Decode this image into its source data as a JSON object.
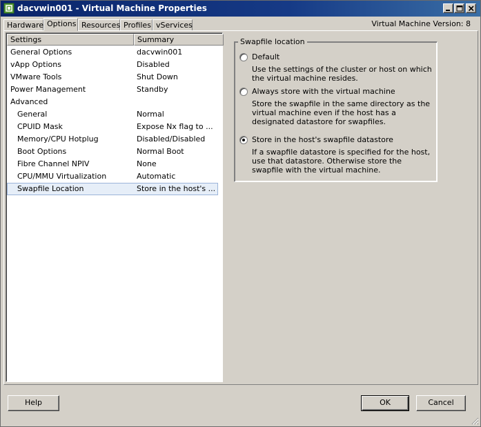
{
  "window": {
    "title": "dacvwin001 - Virtual Machine Properties"
  },
  "tabs": [
    {
      "label": "Hardware",
      "active": false
    },
    {
      "label": "Options",
      "active": true
    },
    {
      "label": "Resources",
      "active": false
    },
    {
      "label": "Profiles",
      "active": false
    },
    {
      "label": "vServices",
      "active": false
    }
  ],
  "version_text": "Virtual Machine Version: 8",
  "settings_table": {
    "columns": [
      "Settings",
      "Summary"
    ],
    "rows": [
      {
        "name": "General Options",
        "summary": "dacvwin001",
        "indent": false
      },
      {
        "name": "vApp Options",
        "summary": "Disabled",
        "indent": false
      },
      {
        "name": "VMware Tools",
        "summary": "Shut Down",
        "indent": false
      },
      {
        "name": "Power Management",
        "summary": "Standby",
        "indent": false
      },
      {
        "name": "Advanced",
        "summary": "",
        "indent": false
      },
      {
        "name": "General",
        "summary": "Normal",
        "indent": true
      },
      {
        "name": "CPUID Mask",
        "summary": "Expose Nx flag to ...",
        "indent": true
      },
      {
        "name": "Memory/CPU Hotplug",
        "summary": "Disabled/Disabled",
        "indent": true
      },
      {
        "name": "Boot Options",
        "summary": "Normal Boot",
        "indent": true
      },
      {
        "name": "Fibre Channel NPIV",
        "summary": "None",
        "indent": true
      },
      {
        "name": "CPU/MMU Virtualization",
        "summary": "Automatic",
        "indent": true
      },
      {
        "name": "Swapfile Location",
        "summary": "Store in the host's ...",
        "indent": true,
        "selected": true
      }
    ]
  },
  "swapfile": {
    "group_label": "Swapfile location",
    "options": [
      {
        "label": "Default",
        "description": "Use the settings of the cluster or host on which the virtual machine resides.",
        "checked": false
      },
      {
        "label": "Always store with the virtual machine",
        "description": "Store the swapfile in the same directory as the virtual machine even if the host has a designated datastore for swapfiles.",
        "checked": false
      },
      {
        "label": "Store in the host's swapfile datastore",
        "description": "If a swapfile datastore is specified for the host, use that datastore. Otherwise store the swapfile with the virtual machine.",
        "checked": true
      }
    ]
  },
  "buttons": {
    "help": "Help",
    "ok": "OK",
    "cancel": "Cancel"
  },
  "colors": {
    "titlebar": "#0a246a",
    "selection": "#e6eef8",
    "face": "#d4d0c8"
  }
}
